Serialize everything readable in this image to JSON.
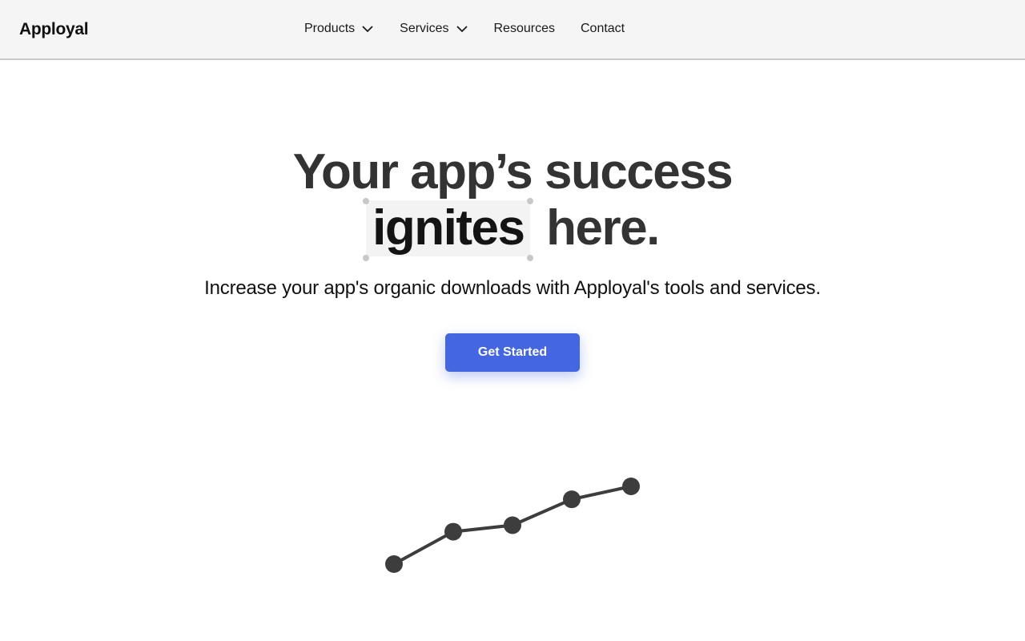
{
  "brand": {
    "name": "Apployal"
  },
  "nav": {
    "items": [
      {
        "label": "Products",
        "dropdown": true
      },
      {
        "label": "Services",
        "dropdown": true
      },
      {
        "label": "Resources",
        "dropdown": false
      },
      {
        "label": "Contact",
        "dropdown": false
      }
    ]
  },
  "hero": {
    "title_line1": "Your app’s success",
    "title_highlight": "ignites",
    "title_line2_rest": "here.",
    "subtitle": "Increase your app's organic downloads with Apployal's tools and services.",
    "cta_label": "Get Started"
  },
  "colors": {
    "cta": "#4466e0",
    "header_bg": "#f5f5f5",
    "chart_line": "#3d3d3d"
  },
  "icons": {
    "dropdown": "chevron-down-icon"
  },
  "graphic": {
    "points": [
      1,
      2,
      2.2,
      3,
      3.4
    ]
  }
}
